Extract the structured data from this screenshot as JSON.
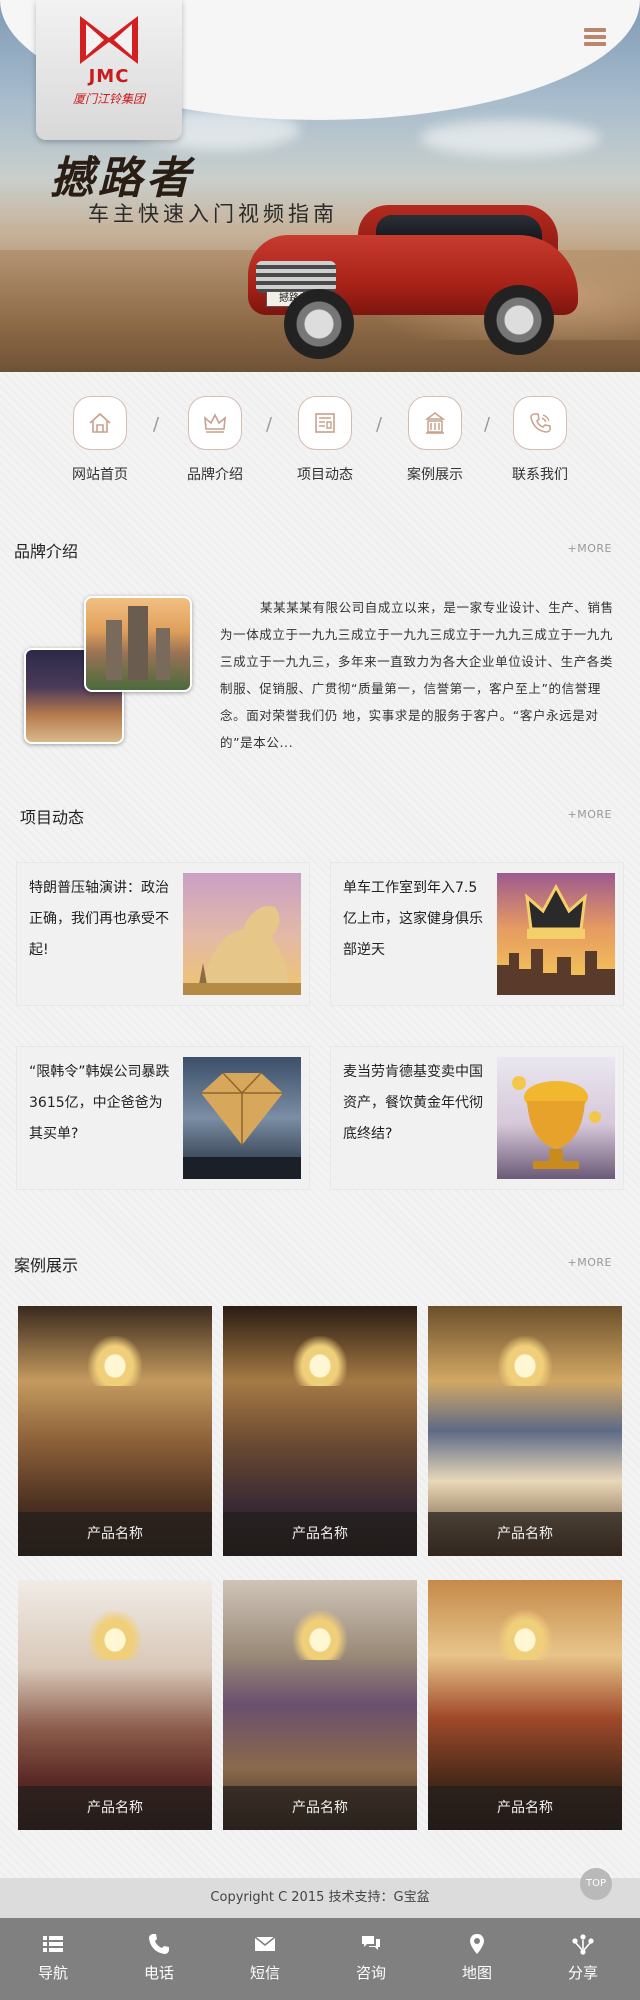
{
  "header": {
    "logo_en": "JMC",
    "logo_cn": "厦门江铃集团",
    "menu_icon": "menu-icon"
  },
  "banner": {
    "title": "撼路者",
    "subtitle": "车主快速入门视频指南",
    "plate": "撼路者"
  },
  "quicknav": [
    {
      "label": "网站首页",
      "icon": "home-icon"
    },
    {
      "label": "品牌介绍",
      "icon": "crown-icon"
    },
    {
      "label": "项目动态",
      "icon": "news-icon"
    },
    {
      "label": "案例展示",
      "icon": "building-icon"
    },
    {
      "label": "联系我们",
      "icon": "phone-icon"
    }
  ],
  "quicknav_sep": "/",
  "brand": {
    "title": "品牌介绍",
    "more": "+MORE",
    "text": "某某某某有限公司自成立以来，是一家专业设计、生产、销售为一体成立于一九九三成立于一九九三成立于一九九三成立于一九九三成立于一九九三，多年来一直致力为各大企业单位设计、生产各类制服、促销服、广贯彻“质量第一，信誉第一，客户至上”的信誉理念。面对荣誉我们仍 地，实事求是的服务于客户。“客户永远是对的”是本公..."
  },
  "news": {
    "title": "项目动态",
    "more": "+MORE",
    "items": [
      {
        "title": "特朗普压轴演讲：政治正确，我们再也承受不起!"
      },
      {
        "title": "单车工作室到年入7.5亿上市，这家健身俱乐部逆天"
      },
      {
        "title": "“限韩令”韩娱公司暴跌3615亿，中企爸爸为其买单?"
      },
      {
        "title": "麦当劳肯德基变卖中国资产，餐饮黄金年代彻底终结?"
      }
    ]
  },
  "cases": {
    "title": "案例展示",
    "more": "+MORE",
    "items": [
      {
        "name": "产品名称"
      },
      {
        "name": "产品名称"
      },
      {
        "name": "产品名称"
      },
      {
        "name": "产品名称"
      },
      {
        "name": "产品名称"
      },
      {
        "name": "产品名称"
      }
    ]
  },
  "footer": {
    "copyright": "Copyright C 2015 技术支持：G宝盆",
    "top": "TOP",
    "bar": [
      {
        "label": "导航",
        "icon": "list-icon"
      },
      {
        "label": "电话",
        "icon": "phone-icon"
      },
      {
        "label": "短信",
        "icon": "mail-icon"
      },
      {
        "label": "咨询",
        "icon": "chat-icon"
      },
      {
        "label": "地图",
        "icon": "map-pin-icon"
      },
      {
        "label": "分享",
        "icon": "share-icon"
      }
    ]
  },
  "colors": {
    "accent": "#c81c1c",
    "bottom_bar": "#808080",
    "icon_tint": "#b8876e"
  }
}
